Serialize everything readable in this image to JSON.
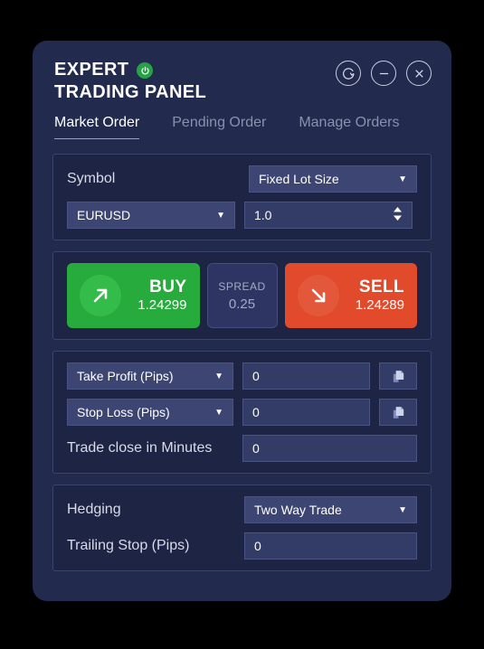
{
  "window": {
    "title_line1": "EXPERT",
    "title_line2": "TRADING PANEL",
    "controls": [
      {
        "name": "refresh",
        "label": "Refresh"
      },
      {
        "name": "minimize",
        "label": "Minimize"
      },
      {
        "name": "close",
        "label": "Close"
      }
    ]
  },
  "tabs": [
    {
      "label": "Market Order",
      "active": true
    },
    {
      "label": "Pending Order",
      "active": false
    },
    {
      "label": "Manage Orders",
      "active": false
    }
  ],
  "symbol_section": {
    "symbol_label": "Symbol",
    "lot_mode": "Fixed Lot Size",
    "symbol_value": "EURUSD",
    "lot_value": "1.0"
  },
  "trade_section": {
    "buy_label": "BUY",
    "buy_price": "1.24299",
    "spread_label": "SPREAD",
    "spread_value": "0.25",
    "sell_label": "SELL",
    "sell_price": "1.24289"
  },
  "risk_section": {
    "take_profit_label": "Take Profit (Pips)",
    "take_profit_value": "0",
    "stop_loss_label": "Stop Loss (Pips)",
    "stop_loss_value": "0",
    "trade_close_label": "Trade close in Minutes",
    "trade_close_value": "0"
  },
  "hedging_section": {
    "hedging_label": "Hedging",
    "hedging_value": "Two Way Trade",
    "trailing_label": "Trailing Stop (Pips)",
    "trailing_value": "0"
  },
  "colors": {
    "page_background": "#000000",
    "panel_background": "#222a4e",
    "card_background": "#1d2444",
    "card_border": "#3b446e",
    "dropdown_background": "#3d4573",
    "input_background": "#333c66",
    "buy_green": "#27ab3d",
    "sell_red": "#e14a2b",
    "power_green": "#25a344",
    "active_tab_text": "#ffffff",
    "inactive_tab_text": "#8b90ad"
  },
  "icons": {
    "power": "power-icon",
    "refresh": "refresh-icon",
    "minimize": "minus-icon",
    "close": "close-icon",
    "buy_arrow": "arrow-up-right-icon",
    "sell_arrow": "arrow-down-right-icon",
    "copy": "copy-icon",
    "caret_down": "▼"
  }
}
